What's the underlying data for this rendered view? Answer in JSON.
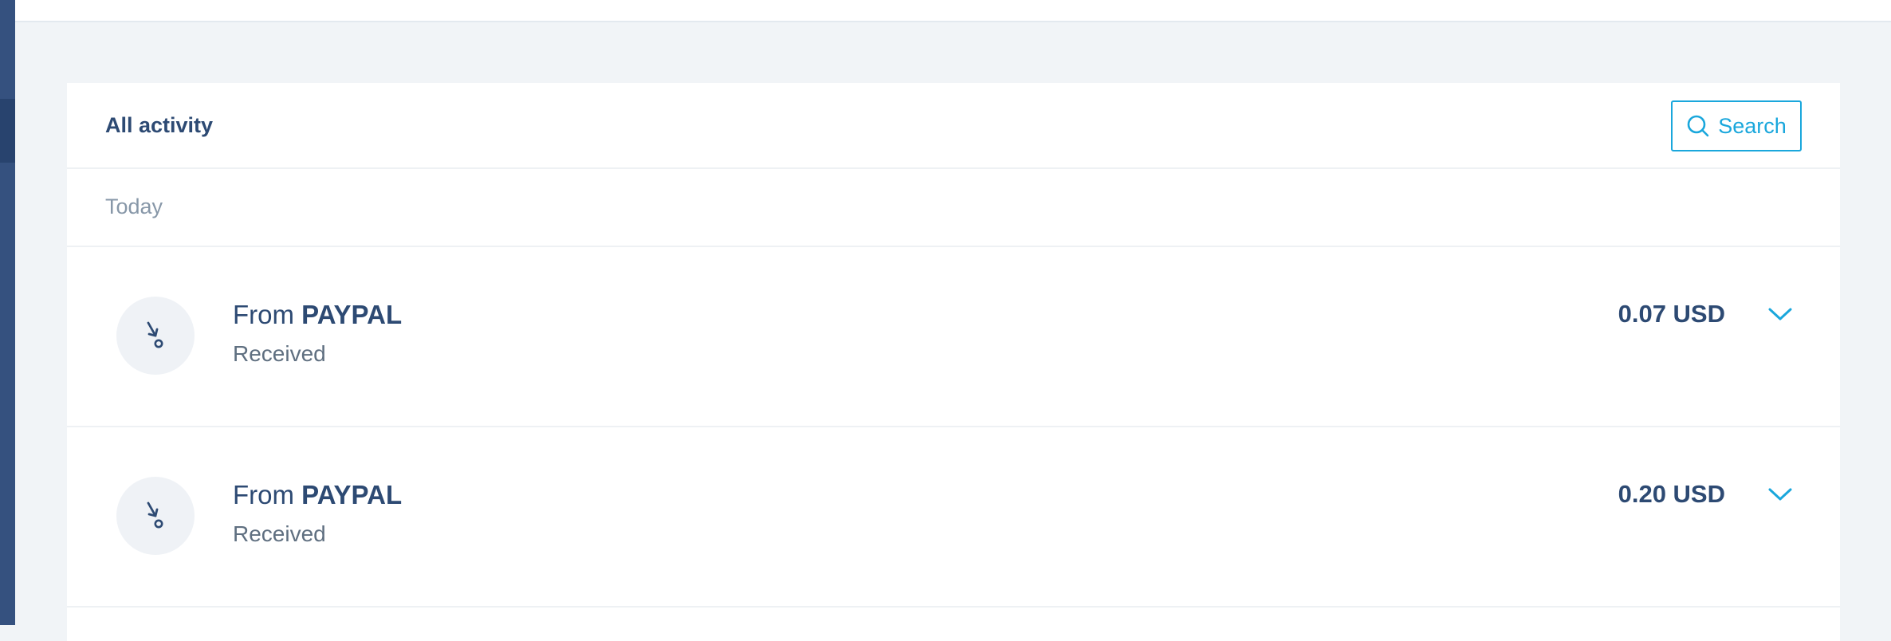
{
  "colors": {
    "accent": "#1aa7dc",
    "text_primary": "#2d4a73",
    "text_muted": "#8797a8",
    "page_background": "#f1f4f7",
    "sidebar": "#35517f"
  },
  "activity": {
    "title": "All activity",
    "search_label": "Search",
    "search_icon": "search-icon",
    "groups": [
      {
        "label": "Today",
        "items": [
          {
            "prefix": "From",
            "party": "PAYPAL",
            "status": "Received",
            "amount": "0.07 USD",
            "icon": "received-arrow-icon",
            "toggle_icon": "chevron-down-icon"
          },
          {
            "prefix": "From",
            "party": "PAYPAL",
            "status": "Received",
            "amount": "0.20 USD",
            "icon": "received-arrow-icon",
            "toggle_icon": "chevron-down-icon"
          }
        ]
      }
    ]
  }
}
